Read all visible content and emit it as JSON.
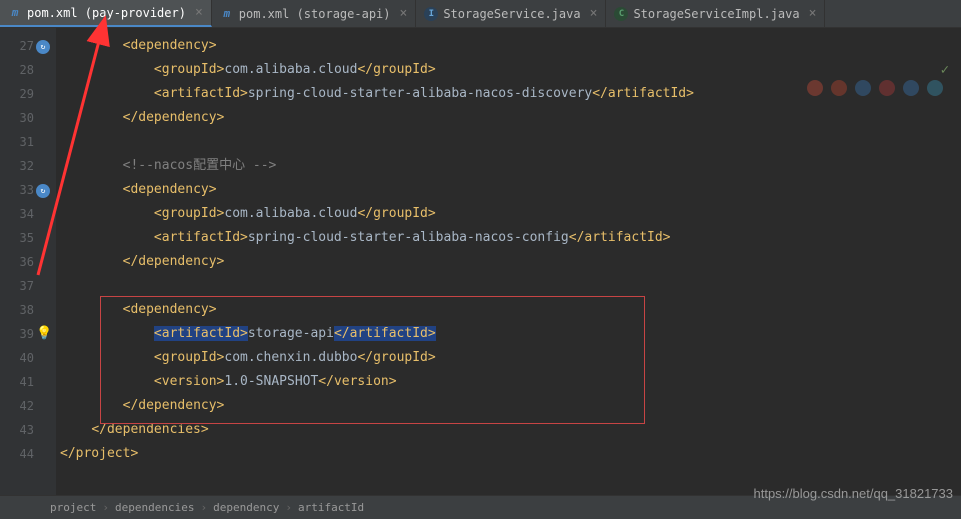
{
  "tabs": [
    {
      "label": "pom.xml (pay-provider)",
      "icon": "m",
      "iconType": "maven",
      "active": true
    },
    {
      "label": "pom.xml (storage-api)",
      "icon": "m",
      "iconType": "maven",
      "active": false
    },
    {
      "label": "StorageService.java",
      "icon": "I",
      "iconType": "interface",
      "active": false
    },
    {
      "label": "StorageServiceImpl.java",
      "icon": "C",
      "iconType": "class",
      "active": false
    }
  ],
  "lineNumbers": [
    "27",
    "28",
    "29",
    "30",
    "31",
    "32",
    "33",
    "34",
    "35",
    "36",
    "37",
    "38",
    "39",
    "40",
    "41",
    "42",
    "43",
    "44",
    ""
  ],
  "code": {
    "l27": {
      "indent": "        ",
      "openTag": "<dependency>",
      "closeTag": ""
    },
    "l28": {
      "indent": "            ",
      "openTag": "<groupId>",
      "content": "com.alibaba.cloud",
      "closeTag": "</groupId>"
    },
    "l29": {
      "indent": "            ",
      "openTag": "<artifactId>",
      "content": "spring-cloud-starter-alibaba-nacos-discovery",
      "closeTag": "</artifactId>"
    },
    "l30": {
      "indent": "        ",
      "openTag": "</dependency>",
      "closeTag": ""
    },
    "l31": {
      "indent": "",
      "openTag": "",
      "closeTag": ""
    },
    "l32": {
      "indent": "        ",
      "comment": "<!--nacos配置中心 -->"
    },
    "l33": {
      "indent": "        ",
      "openTag": "<dependency>",
      "closeTag": ""
    },
    "l34": {
      "indent": "            ",
      "openTag": "<groupId>",
      "content": "com.alibaba.cloud",
      "closeTag": "</groupId>"
    },
    "l35": {
      "indent": "            ",
      "openTag": "<artifactId>",
      "content": "spring-cloud-starter-alibaba-nacos-config",
      "closeTag": "</artifactId>"
    },
    "l36": {
      "indent": "        ",
      "openTag": "</dependency>",
      "closeTag": ""
    },
    "l37": {
      "indent": "",
      "openTag": "",
      "closeTag": ""
    },
    "l38": {
      "indent": "        ",
      "openTag": "<dependency>",
      "closeTag": ""
    },
    "l39": {
      "indent": "            ",
      "openTag": "<artifactId>",
      "content": "storage-api",
      "closeTag": "</artifactId>",
      "highlight": true
    },
    "l40": {
      "indent": "            ",
      "openTag": "<groupId>",
      "content": "com.chenxin.dubbo",
      "closeTag": "</groupId>"
    },
    "l41": {
      "indent": "            ",
      "openTag": "<version>",
      "content": "1.0-SNAPSHOT",
      "closeTag": "</version>"
    },
    "l42": {
      "indent": "        ",
      "openTag": "</dependency>",
      "closeTag": ""
    },
    "l43": {
      "indent": "    ",
      "openTag": "</dependencies>",
      "closeTag": ""
    },
    "l44": {
      "indent": "",
      "openTag": "</project>",
      "closeTag": ""
    }
  },
  "breadcrumb": [
    "project",
    "dependencies",
    "dependency",
    "artifactId"
  ],
  "watermark": "https://blog.csdn.net/qq_31821733"
}
